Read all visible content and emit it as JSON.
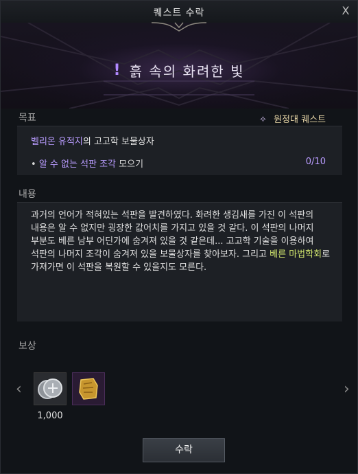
{
  "window": {
    "title": "퀘스트 수락",
    "close_label": "X"
  },
  "quest": {
    "mark": "!",
    "title": "흙 속의 화려한 빛",
    "type": "원정대 퀘스트"
  },
  "objective": {
    "label": "목표",
    "target_name": "벨리온 유적지",
    "target_suffix": "의 고고학 보물상자",
    "bullet": "•",
    "item_name": "알 수 없는 석판 조각",
    "action": " 모으기",
    "progress": "0/10"
  },
  "content": {
    "label": "내용",
    "text_before": "과거의 언어가 적혀있는 석판을 발견하였다. 화려한 생김새를 가진 이 석판의 내용은 알 수 없지만 굉장한 값어치를 가지고 있을 것 같다. 이 석판의 나머지 부분도 베른 남부 어딘가에 숨겨져 있을 것 같은데... 고고학 기술을 이용하여 석판의 나머지 조각이 숨겨져 있을 보물상자를 찾아보자. 그리고 ",
    "highlight": "베른 마법학회",
    "text_after": "로 가져가면 이 석판을 복원할 수 있을지도 모른다."
  },
  "reward": {
    "label": "보상",
    "items": [
      {
        "icon": "silver-coin-icon",
        "count": "1,000"
      },
      {
        "icon": "gold-relic-icon",
        "count": ""
      }
    ]
  },
  "buttons": {
    "accept": "수락",
    "prev": "‹",
    "next": "›"
  }
}
